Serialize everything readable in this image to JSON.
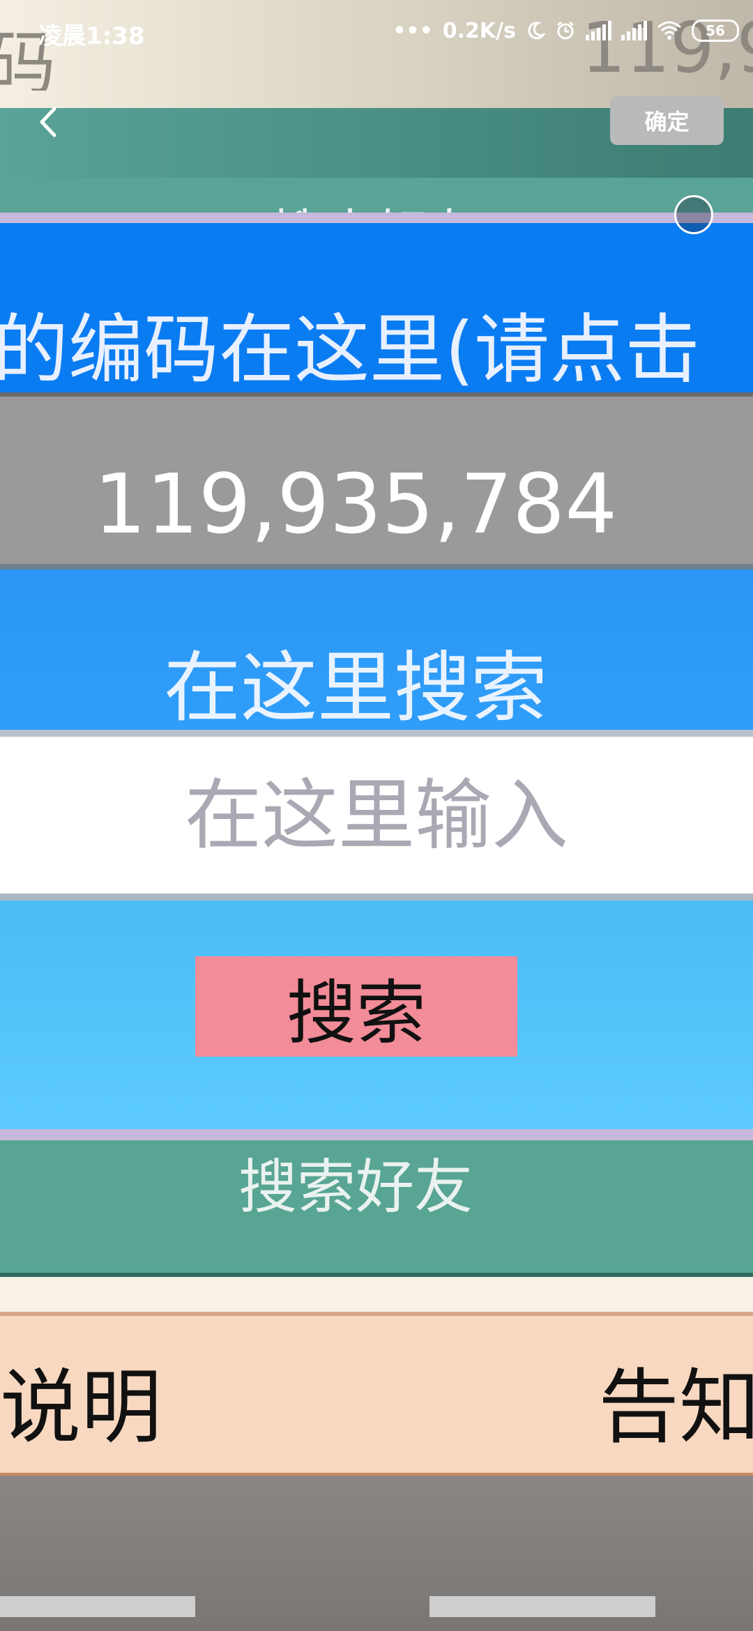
{
  "status_bar": {
    "time": "凌晨1:38",
    "network_speed": "0.2K/s",
    "battery": "56",
    "icons": [
      "moon-icon",
      "alarm-icon",
      "signal-icon",
      "signal-icon",
      "wifi-icon",
      "battery-icon"
    ]
  },
  "background": {
    "left_text": "码",
    "right_text": "119,9"
  },
  "toolbar": {
    "confirm_label": "确定",
    "title_partial": "搜索好友"
  },
  "card": {
    "header_text": "的编码在这里(请点击",
    "code_value": "119,935,784",
    "search_label": "在这里搜索",
    "input_placeholder": "在这里输入",
    "search_button_label": "搜索"
  },
  "lower": {
    "friend_label": "搜索好友",
    "info_left": "说明",
    "info_right": "告知"
  },
  "colors": {
    "header_blue": "#0a7cf2",
    "search_blue": "#2f9efa",
    "button_pink": "#f28c98",
    "teal": "#5aa397"
  }
}
